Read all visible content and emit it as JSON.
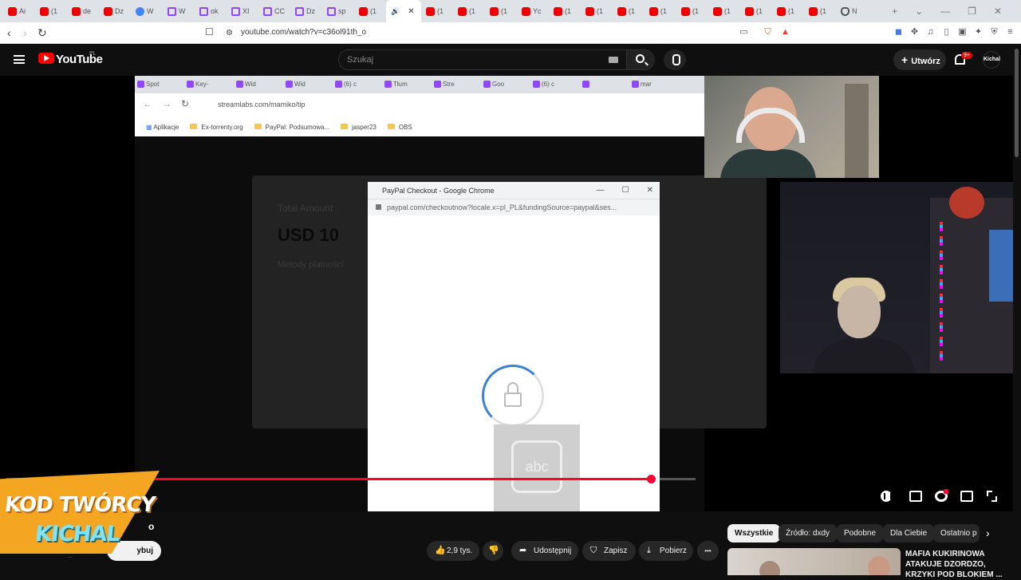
{
  "browser": {
    "tabs": [
      {
        "label": "Ai",
        "icon": "youtube"
      },
      {
        "label": "(1",
        "icon": "youtube"
      },
      {
        "label": "de",
        "icon": "youtube"
      },
      {
        "label": "Dz",
        "icon": "youtube"
      },
      {
        "label": "W",
        "icon": "globe"
      },
      {
        "label": "W",
        "icon": "twitch"
      },
      {
        "label": "ok",
        "icon": "twitch"
      },
      {
        "label": "XI",
        "icon": "twitch"
      },
      {
        "label": "CC",
        "icon": "twitch"
      },
      {
        "label": "Dz",
        "icon": "twitch"
      },
      {
        "label": "sp",
        "icon": "twitch"
      },
      {
        "label": "(1",
        "icon": "youtube"
      },
      {
        "label": "",
        "icon": "speaker",
        "active": true
      },
      {
        "label": "(1",
        "icon": "youtube"
      },
      {
        "label": "(1",
        "icon": "youtube"
      },
      {
        "label": "(1",
        "icon": "youtube"
      },
      {
        "label": "Yc",
        "icon": "youtube"
      },
      {
        "label": "(1",
        "icon": "youtube"
      },
      {
        "label": "(1",
        "icon": "youtube"
      },
      {
        "label": "(1",
        "icon": "youtube"
      },
      {
        "label": "(1",
        "icon": "youtube"
      },
      {
        "label": "(1",
        "icon": "youtube"
      },
      {
        "label": "(1",
        "icon": "youtube"
      },
      {
        "label": "(1",
        "icon": "youtube"
      },
      {
        "label": "(1",
        "icon": "youtube"
      },
      {
        "label": "(1",
        "icon": "youtube"
      },
      {
        "label": "N",
        "icon": "shield"
      }
    ],
    "url": "youtube.com/watch?v=c36ol91th_o",
    "new_tab": "+",
    "window_controls": [
      "⌄",
      "—",
      "❐",
      "✕"
    ]
  },
  "youtube": {
    "logo_text": "YouTube",
    "region": "PL",
    "search_placeholder": "Szukaj",
    "create_label": "Utwórz",
    "notif_badge": "9+",
    "avatar_text": "Kichal"
  },
  "video": {
    "inner_tabs": [
      "Spot",
      "Key-",
      "Wid",
      "Wid",
      "(6) c",
      "Tłum",
      "Stre",
      "Goo",
      "(6) c",
      "",
      "mar"
    ],
    "inner_url": "streamlabs.com/mamiko/tip",
    "inner_bookmarks": [
      "Aplikacje",
      "Ex-torrenty.org",
      "PayPal: Podsumowa...",
      "jasper23",
      "OBS"
    ],
    "modal_total_label": "Total Amount",
    "modal_amount": "USD 10",
    "modal_methods": "Metody płatności",
    "paypal_title": "PayPal Checkout - Google Chrome",
    "paypal_url": "paypal.com/checkoutnow?locale.x=pl_PL&fundingSource=paypal&ses...",
    "abc_text": "abc",
    "progress_fraction": 0.935,
    "creator_code_line1": "KOD TWÓRCY",
    "creator_code_line2": "KICHAL"
  },
  "below": {
    "title_fragment": "o",
    "subscribe_label": "Subskrybuj",
    "subscribe_visible": "ybuj",
    "likes": "2,9 tys.",
    "share_label": "Udostępnij",
    "save_label": "Zapisz",
    "download_label": "Pobierz",
    "more_label": "•••",
    "chips": [
      "Wszystkie",
      "Źródło: dxdy",
      "Podobne",
      "Dla Ciebie",
      "Ostatnio p"
    ],
    "rec_title": "MAFIA KUKIRINOWA ATAKUJE DZORDZO, KRZYKI POD BLOKIEM ..."
  },
  "colors": {
    "accent": "#ff0033",
    "orange": "#f4a622",
    "cyan": "#7fe3f3"
  }
}
